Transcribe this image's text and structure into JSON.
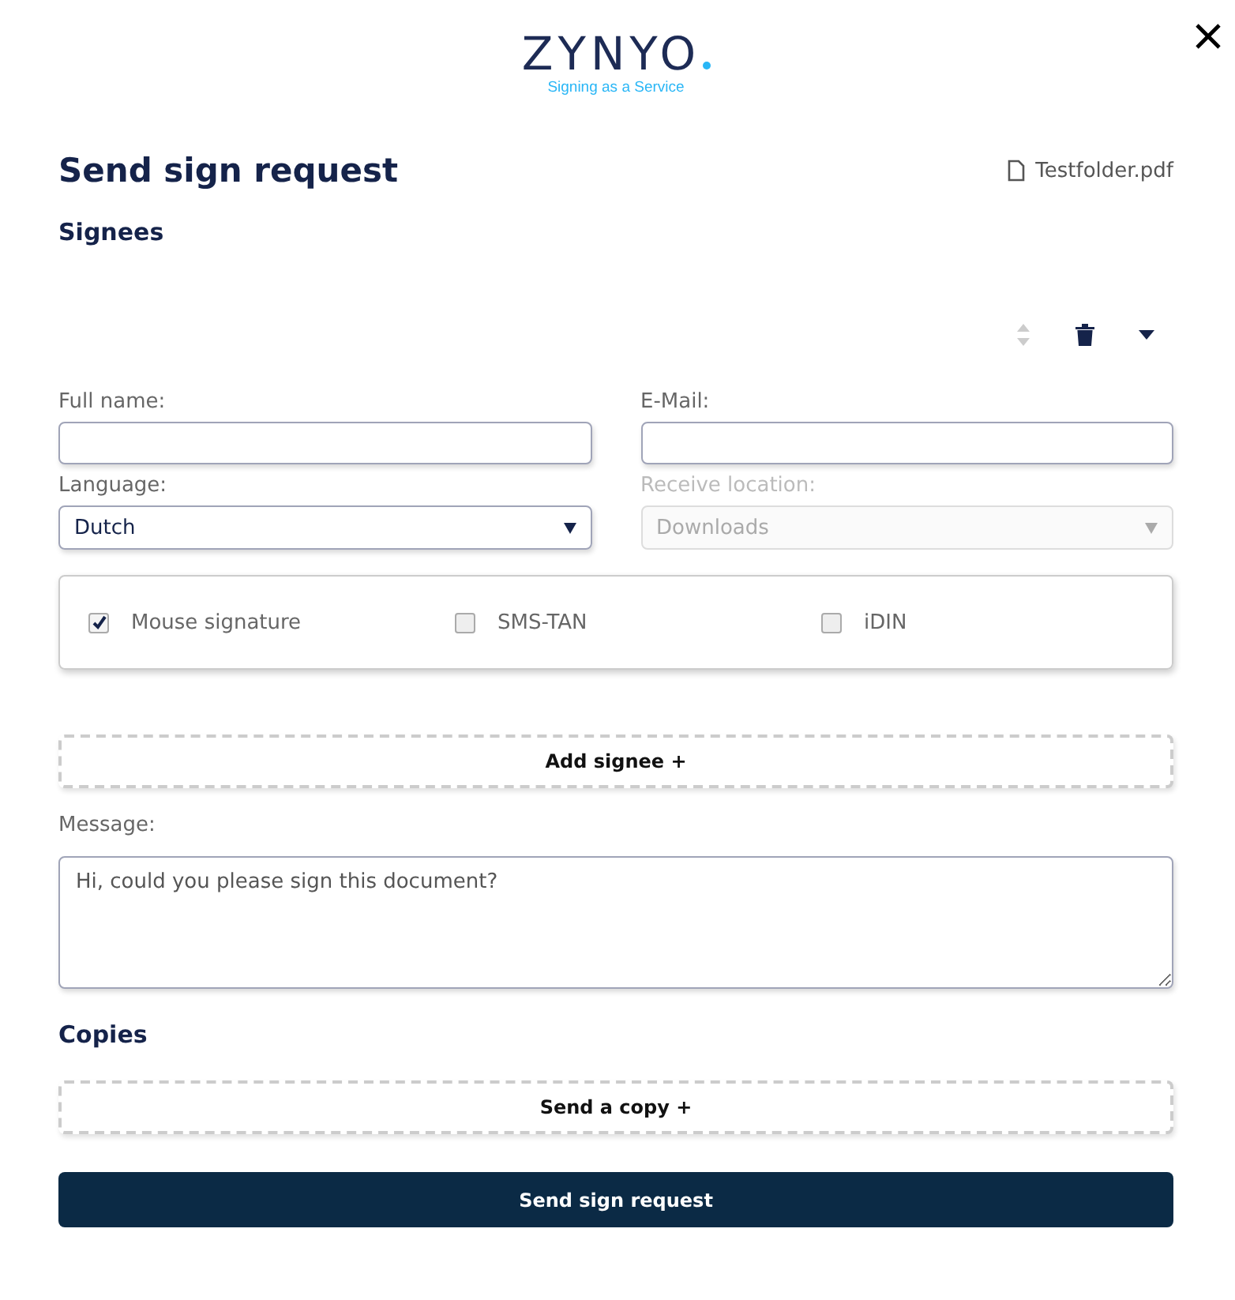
{
  "logo": {
    "brand": "ZYNYO",
    "tagline": "Signing as a Service"
  },
  "title": "Send sign request",
  "file": "Testfolder.pdf",
  "signees": {
    "heading": "Signees",
    "fields": [
      {
        "label": "Full name:",
        "kind": "input",
        "disabled": false
      },
      {
        "label": "E-Mail:",
        "kind": "input",
        "disabled": false
      },
      {
        "label": "Language:",
        "kind": "select",
        "value": "Dutch",
        "disabled": false
      },
      {
        "label": "Receive location:",
        "kind": "select",
        "value": "Downloads",
        "disabled": true
      }
    ],
    "methods": [
      {
        "label": "Mouse signature",
        "checked": true
      },
      {
        "label": "SMS-TAN",
        "checked": false
      },
      {
        "label": "iDIN",
        "checked": false
      }
    ],
    "add_button": "Add signee +"
  },
  "message": {
    "label": "Message:",
    "value": "Hi, could you please sign this document?"
  },
  "copies": {
    "heading": "Copies",
    "add_button": "Send a copy +"
  },
  "submit": "Send sign request"
}
